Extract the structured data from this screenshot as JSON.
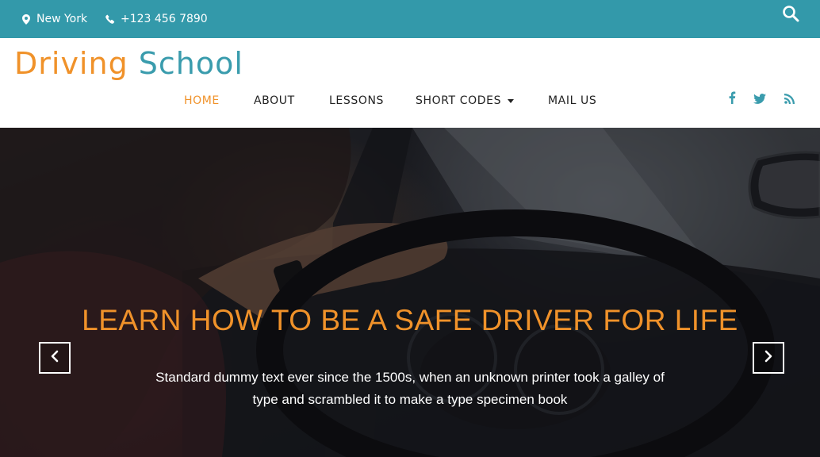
{
  "topbar": {
    "location": "New York",
    "phone": "+123 456 7890",
    "location_icon": "map-pin-icon",
    "phone_icon": "phone-icon",
    "search_icon": "search-icon"
  },
  "brand": {
    "word1": "Driving",
    "word2": "School"
  },
  "nav": {
    "items": [
      {
        "label": "HOME",
        "active": true
      },
      {
        "label": "ABOUT",
        "active": false
      },
      {
        "label": "LESSONS",
        "active": false
      },
      {
        "label": "SHORT CODES",
        "active": false,
        "dropdown": true
      },
      {
        "label": "MAIL US",
        "active": false
      }
    ]
  },
  "social": [
    "facebook-icon",
    "twitter-icon",
    "rss-icon"
  ],
  "hero": {
    "title": "LEARN HOW TO BE A SAFE DRIVER FOR LIFE",
    "text": "Standard dummy text ever since the 1500s, when an unknown printer took a galley of type and scrambled it to make a type specimen book"
  },
  "colors": {
    "topbar": "#3399aa",
    "accent_orange": "#f0922a",
    "accent_teal": "#3a9cad",
    "nav_text": "#222222"
  }
}
